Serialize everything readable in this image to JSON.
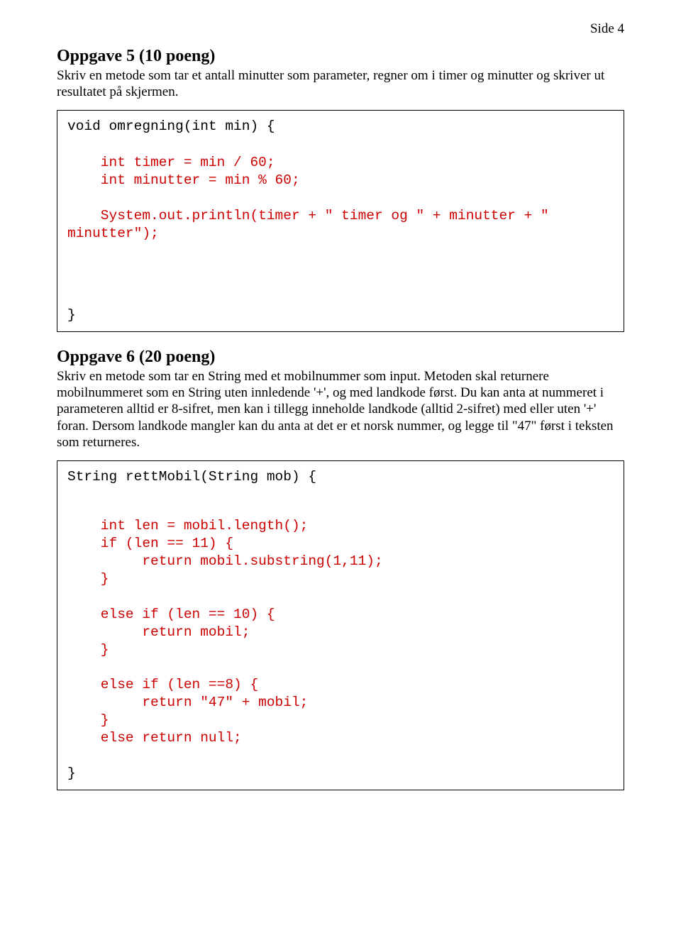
{
  "pageNumber": "Side 4",
  "task5": {
    "heading": "Oppgave 5 (10 poeng)",
    "desc": "Skriv en metode som tar et antall minutter som parameter, regner om i timer og minutter og skriver ut resultatet på skjermen.",
    "sig": "void omregning(int min) {",
    "l1": "    int timer = min / 60;",
    "l2": "    int minutter = min % 60;",
    "l3": "    System.out.println(timer + \" timer og \" + minutter + \"",
    "l4": "minutter\");",
    "close": "}"
  },
  "task6": {
    "heading": "Oppgave 6 (20 poeng)",
    "desc": "Skriv en metode som tar en String med et mobilnummer som input. Metoden skal returnere mobilnummeret som en String uten innledende '+', og med landkode først. Du kan anta at nummeret i parameteren alltid er 8-sifret, men kan i tillegg inneholde landkode (alltid 2-sifret) med eller uten '+' foran. Dersom landkode mangler kan du anta at det er et norsk nummer, og legge til \"47\" først i teksten som returneres.",
    "sig": "String rettMobil(String mob) {",
    "l1": "    int len = mobil.length();",
    "l2": "    if (len == 11) {",
    "l3": "         return mobil.substring(1,11);",
    "l4": "    }",
    "l5": "    else if (len == 10) {",
    "l6": "         return mobil;",
    "l7": "    }",
    "l8": "    else if (len ==8) {",
    "l9": "         return \"47\" + mobil;",
    "l10": "    }",
    "l11": "    else return null;",
    "close": "}"
  }
}
